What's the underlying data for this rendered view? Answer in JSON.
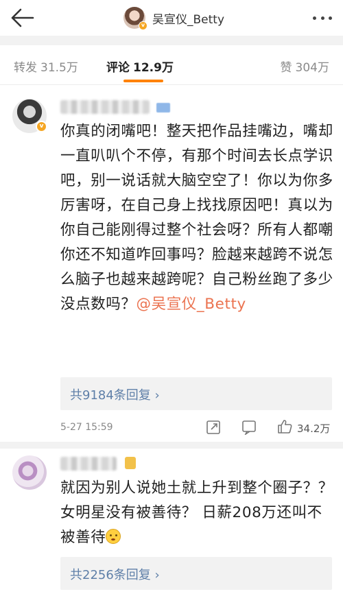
{
  "header": {
    "title": "吴宣仪_Betty",
    "back_icon": "back-arrow-icon",
    "more_icon": "more-dots-icon"
  },
  "tabs": [
    {
      "label": "转发",
      "count": "31.5万"
    },
    {
      "label": "评论",
      "count": "12.9万",
      "active": true
    },
    {
      "label": "赞",
      "count": "304万"
    }
  ],
  "comments": [
    {
      "text_before_mention": "你真的闭嘴吧！整天把作品挂嘴边，嘴却一直叭叭个不停，有那个时间去长点学识吧，别一说话就大脑空空了！你以为你多厉害呀，在自己身上找找原因吧！真以为你自己能刚得过整个社会呀？所有人都嘲你还不知道咋回事吗？脸越来越跨不说怎么脑子也越来越跨呢？自己粉丝跑了多少没点数吗？",
      "mention": "@吴宣仪_Betty",
      "replies_label": "共9184条回复 ›",
      "time": "5-27 15:59",
      "likes": "34.2万"
    },
    {
      "text": "就因为别人说她土就上升到整个圈子？？ 女明星没有被善待？ 日薪208万还叫不被善待",
      "replies_label": "共2256条回复 ›"
    }
  ],
  "colors": {
    "accent": "#ff8200",
    "mention": "#eb7350",
    "link": "#5e7fa8",
    "verified_badge": "#f5a623"
  }
}
